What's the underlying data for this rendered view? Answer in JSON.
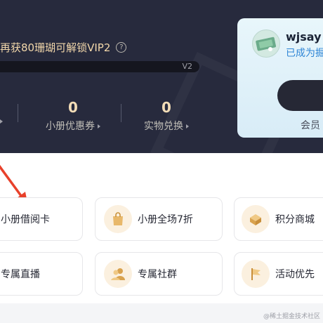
{
  "header": {
    "vip_progress_text": "再获80珊瑚可解锁VIP2",
    "help_icon": "question-circle-icon",
    "progress_label": "V2",
    "stats": [
      {
        "value": "0",
        "label": "小册优惠券"
      },
      {
        "value": "0",
        "label": "实物兑换"
      }
    ]
  },
  "member_card": {
    "username": "wjsay",
    "status_text": "已成为掘",
    "footer_text": "会员"
  },
  "benefits": [
    {
      "label": "小册借阅卡",
      "icon": "card-icon"
    },
    {
      "label": "小册全场7折",
      "icon": "shopping-bag-icon"
    },
    {
      "label": "积分商城",
      "icon": "gift-box-icon"
    },
    {
      "label": "专属直播",
      "icon": "live-icon"
    },
    {
      "label": "专属社群",
      "icon": "community-icon"
    },
    {
      "label": "活动优先",
      "icon": "flag-icon"
    }
  ],
  "colors": {
    "header_bg": "#272a3d",
    "gold_text": "#f2d7aa",
    "card_bg": "#e2f3fa",
    "arrow": "#e8412b"
  },
  "watermark": "@稀土掘金技术社区"
}
